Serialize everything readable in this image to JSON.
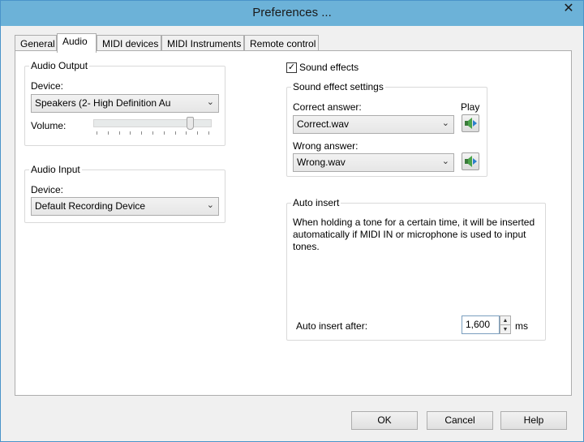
{
  "window": {
    "title": "Preferences ...",
    "close_glyph": "✕"
  },
  "tabs": [
    {
      "label": "General"
    },
    {
      "label": "Audio"
    },
    {
      "label": "MIDI devices"
    },
    {
      "label": "MIDI Instruments"
    },
    {
      "label": "Remote control"
    }
  ],
  "active_tab": "Audio",
  "audio_output": {
    "legend": "Audio Output",
    "device_label": "Device:",
    "device_value": "Speakers (2- High Definition Au",
    "volume_label": "Volume:",
    "volume_fraction": 0.82
  },
  "audio_input": {
    "legend": "Audio Input",
    "device_label": "Device:",
    "device_value": "Default Recording Device"
  },
  "sound_effects": {
    "checkbox_label": "Sound effects",
    "checked": true,
    "check_glyph": "✓",
    "settings_legend": "Sound effect settings",
    "correct_label": "Correct answer:",
    "correct_value": "Correct.wav",
    "wrong_label": "Wrong answer:",
    "wrong_value": "Wrong.wav",
    "play_label": "Play"
  },
  "auto_insert": {
    "legend": "Auto insert",
    "description": "When holding a tone for a certain time, it will be inserted automatically if MIDI IN or microphone is used to input tones.",
    "after_label": "Auto insert after:",
    "value": "1,600",
    "unit": "ms"
  },
  "buttons": {
    "ok": "OK",
    "cancel": "Cancel",
    "help": "Help"
  },
  "glyphs": {
    "dropdown": "⌄",
    "spin_up": "▲",
    "spin_down": "▼"
  }
}
